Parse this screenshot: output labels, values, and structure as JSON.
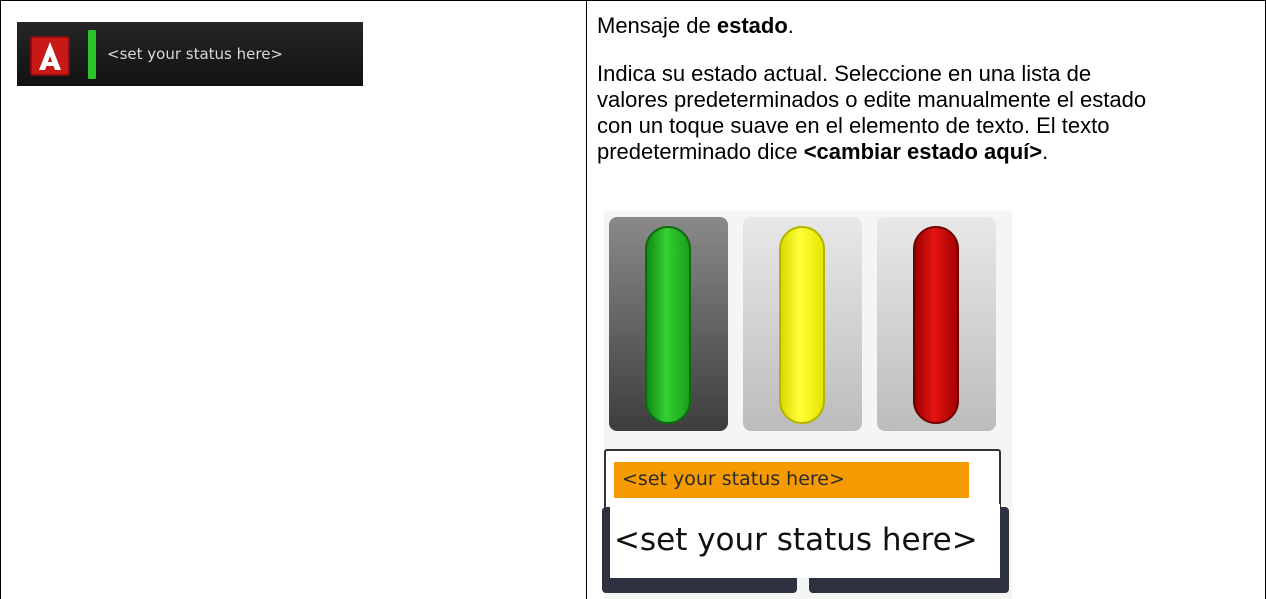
{
  "left_panel": {
    "logo_icon": "app-logo-a-icon",
    "status_text": "<set your status here>",
    "indicator_color": "#2bc52b"
  },
  "right_panel": {
    "heading_prefix": "Mensaje de ",
    "heading_bold": "estado",
    "heading_suffix": ".",
    "description_main": "Indica su estado actual. Seleccione en una lista de valores predeterminados o edite manualmente el estado con un toque suave en el elemento de texto. El texto predeterminado dice ",
    "description_bold": "<cambiar estado aquí>",
    "description_suffix": "."
  },
  "status_panel": {
    "levers": [
      {
        "name": "green",
        "color": "#35d035"
      },
      {
        "name": "yellow",
        "color": "#ffff3a"
      },
      {
        "name": "red",
        "color": "#e51414"
      }
    ],
    "dropdown_option": "<set your status here>",
    "input_value": "<set your status here>",
    "highlight_color": "#f59a00"
  }
}
